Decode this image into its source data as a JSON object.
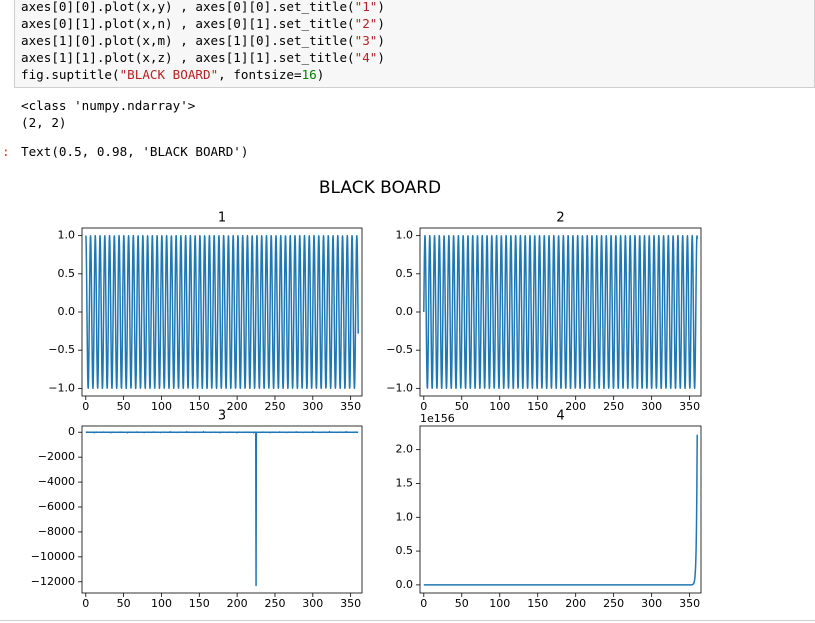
{
  "code_cell": {
    "lines": [
      [
        {
          "t": "axes[0][0].plot(x,y) , axes[0][0].set_title(",
          "c": ""
        },
        {
          "t": "\"1\"",
          "c": "str"
        },
        {
          "t": ")",
          "c": ""
        }
      ],
      [
        {
          "t": "axes[0][1].plot(x,n) , axes[0][1].set_title(",
          "c": ""
        },
        {
          "t": "\"2\"",
          "c": "str"
        },
        {
          "t": ")",
          "c": ""
        }
      ],
      [
        {
          "t": "axes[1][0].plot(x,m) , axes[1][0].set_title(",
          "c": ""
        },
        {
          "t": "\"3\"",
          "c": "str"
        },
        {
          "t": ")",
          "c": ""
        }
      ],
      [
        {
          "t": "axes[1][1].plot(x,z) , axes[1][1].set_title(",
          "c": ""
        },
        {
          "t": "\"4\"",
          "c": "str"
        },
        {
          "t": ")",
          "c": ""
        }
      ],
      [
        {
          "t": "fig.suptitle(",
          "c": ""
        },
        {
          "t": "\"BLACK BOARD\"",
          "c": "str"
        },
        {
          "t": ", fontsize=",
          "c": ""
        },
        {
          "t": "16",
          "c": "num"
        },
        {
          "t": ")",
          "c": ""
        }
      ]
    ]
  },
  "output": {
    "stream_lines": [
      "<class 'numpy.ndarray'>",
      "(2, 2)"
    ],
    "prompt": ":",
    "result_text": "Text(0.5, 0.98, 'BLACK BOARD')"
  },
  "figure": {
    "suptitle": "BLACK BOARD",
    "line_color": "#1f77b4"
  },
  "chart_data": [
    {
      "type": "line",
      "title": "1",
      "xlim": [
        -5,
        365
      ],
      "ylim": [
        -1.1,
        1.1
      ],
      "xticks": [
        0,
        50,
        100,
        150,
        200,
        250,
        300,
        350
      ],
      "yticks": [
        1.0,
        0.5,
        0.0,
        -0.5,
        -1.0
      ],
      "ytick_labels": [
        "1.0",
        "0.5",
        "0.0",
        "−0.5",
        "−1.0"
      ],
      "series": [
        {
          "function": "cos(x)",
          "x_range": [
            0,
            360
          ]
        }
      ]
    },
    {
      "type": "line",
      "title": "2",
      "xlim": [
        -5,
        365
      ],
      "ylim": [
        -1.1,
        1.1
      ],
      "xticks": [
        0,
        50,
        100,
        150,
        200,
        250,
        300,
        350
      ],
      "yticks": [
        1.0,
        0.5,
        0.0,
        -0.5,
        -1.0
      ],
      "ytick_labels": [
        "1.0",
        "0.5",
        "0.0",
        "−0.5",
        "−1.0"
      ],
      "series": [
        {
          "function": "sin(x)",
          "x_range": [
            0,
            360
          ]
        }
      ]
    },
    {
      "type": "line",
      "title": "3",
      "xlim": [
        -5,
        365
      ],
      "ylim": [
        -12900,
        500
      ],
      "xticks": [
        0,
        50,
        100,
        150,
        200,
        250,
        300,
        350
      ],
      "yticks": [
        0,
        -2000,
        -4000,
        -6000,
        -8000,
        -10000,
        -12000
      ],
      "ytick_labels": [
        "0",
        "−2000",
        "−4000",
        "−6000",
        "−8000",
        "−10000",
        "−12000"
      ],
      "series": [
        {
          "function": "tan(x)",
          "x_range": [
            0,
            360
          ],
          "spike": {
            "x": 225,
            "y": -12300
          }
        }
      ]
    },
    {
      "type": "line",
      "title": "4",
      "offset_label": "1e156",
      "xlim": [
        -5,
        365
      ],
      "ylim": [
        -0.12,
        2.35
      ],
      "xticks": [
        0,
        50,
        100,
        150,
        200,
        250,
        300,
        350
      ],
      "yticks": [
        0.0,
        0.5,
        1.0,
        1.5,
        2.0
      ],
      "ytick_labels": [
        "0.0",
        "0.5",
        "1.0",
        "1.5",
        "2.0"
      ],
      "series": [
        {
          "function": "exp(x)",
          "x_range": [
            0,
            360
          ],
          "y_end": 2.22
        }
      ]
    }
  ]
}
